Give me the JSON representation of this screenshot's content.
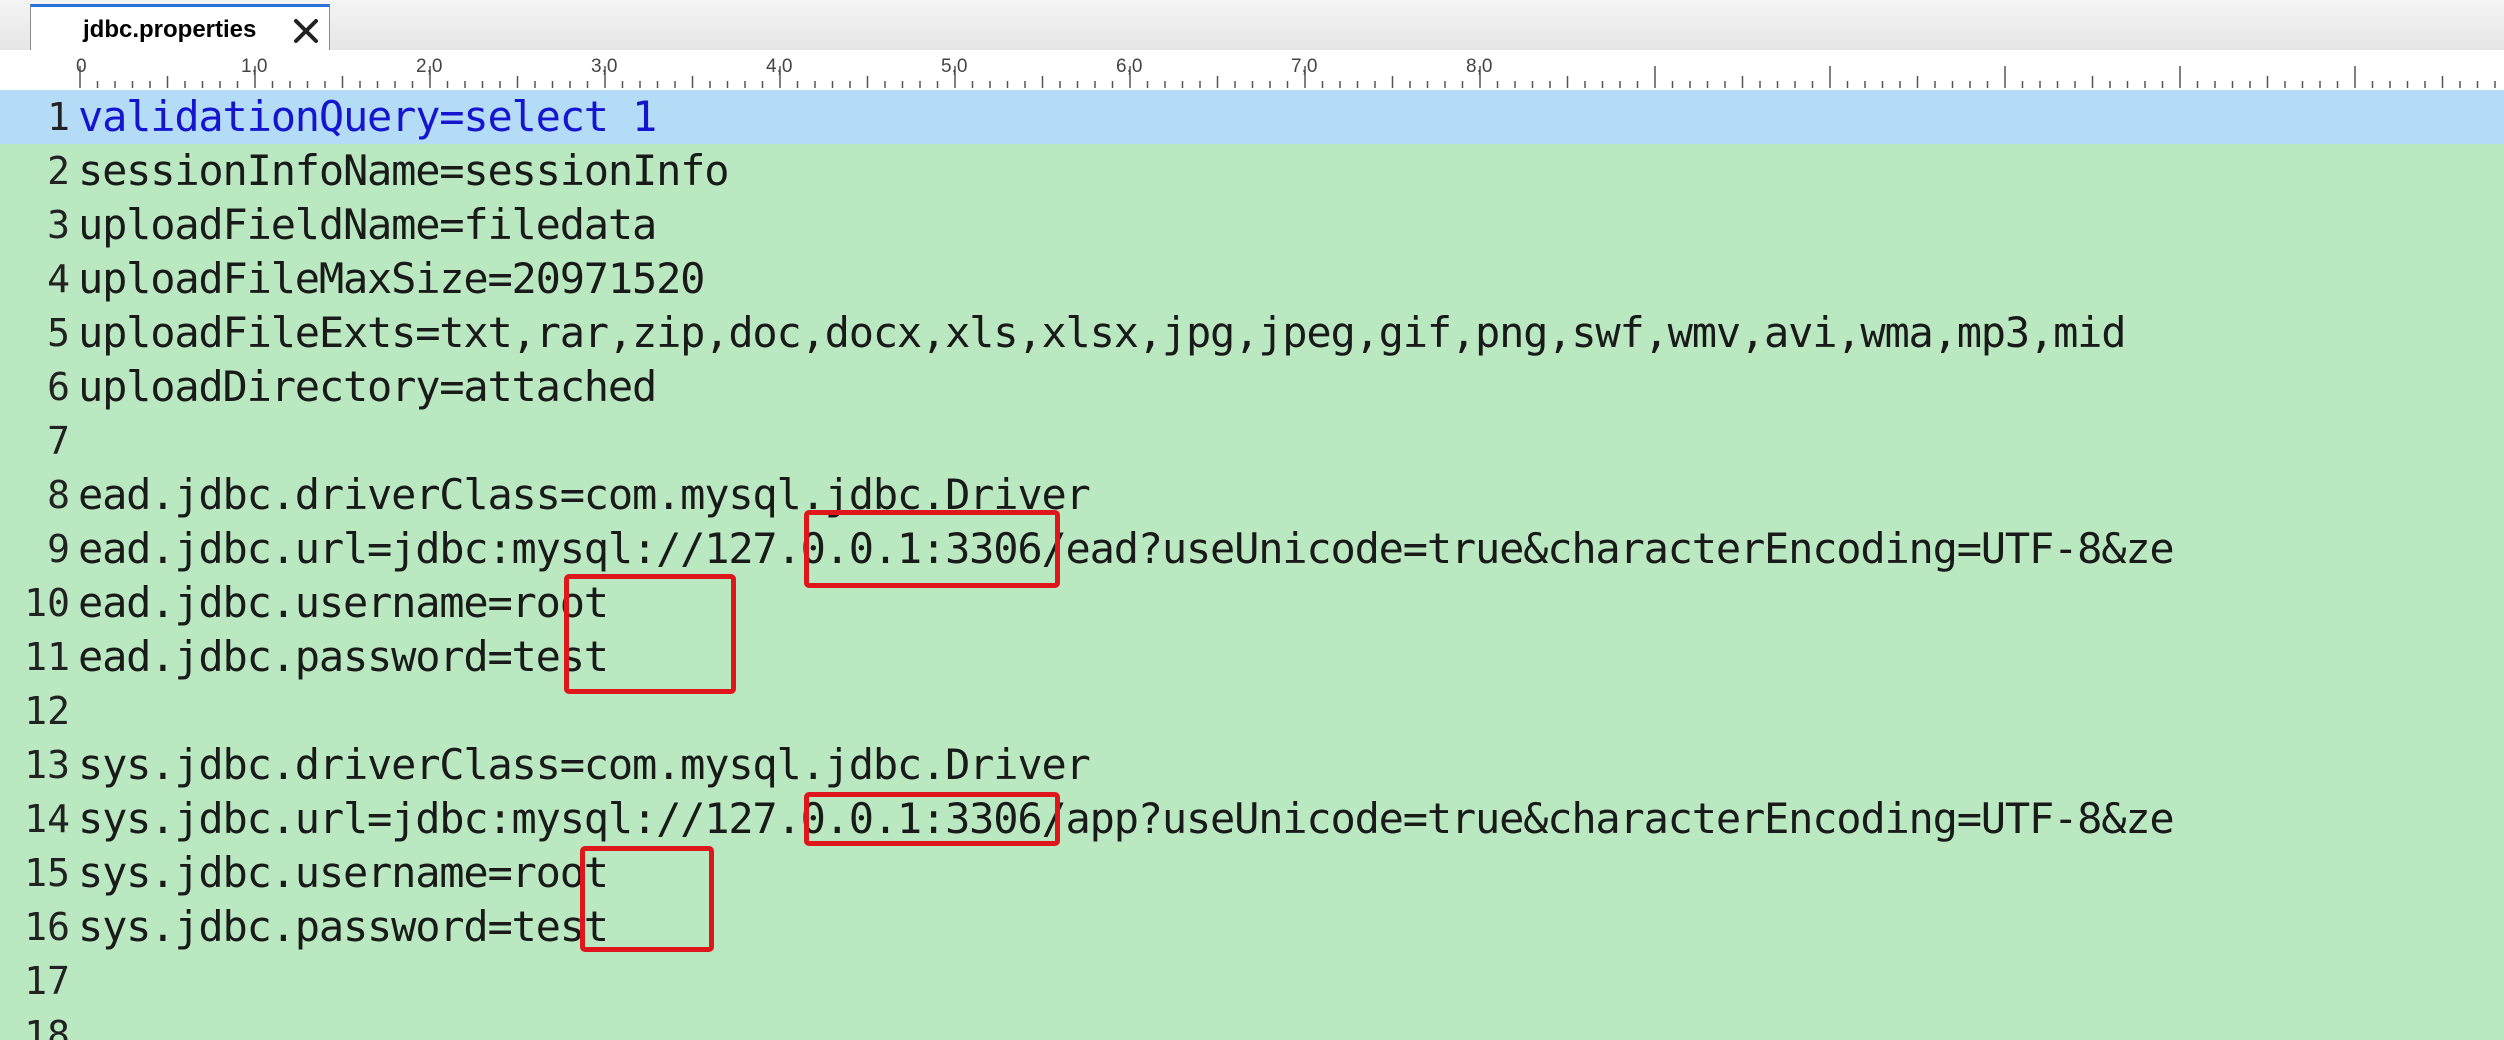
{
  "tab": {
    "title": "jdbc.properties",
    "close_icon": "close-icon"
  },
  "ruler": {
    "labels": [
      "0",
      "1,0",
      "2,0",
      "3,0",
      "4,0",
      "5,0",
      "6,0",
      "7,0",
      "8,0"
    ]
  },
  "editor": {
    "current_line": 1,
    "lines": [
      {
        "num": "1",
        "text": "validationQuery=select 1"
      },
      {
        "num": "2",
        "text": "sessionInfoName=sessionInfo"
      },
      {
        "num": "3",
        "text": "uploadFieldName=filedata"
      },
      {
        "num": "4",
        "text": "uploadFileMaxSize=20971520"
      },
      {
        "num": "5",
        "text": "uploadFileExts=txt,rar,zip,doc,docx,xls,xlsx,jpg,jpeg,gif,png,swf,wmv,avi,wma,mp3,mid"
      },
      {
        "num": "6",
        "text": "uploadDirectory=attached"
      },
      {
        "num": "7",
        "text": ""
      },
      {
        "num": "8",
        "text": "ead.jdbc.driverClass=com.mysql.jdbc.Driver"
      },
      {
        "num": "9",
        "text": "ead.jdbc.url=jdbc:mysql://127.0.0.1:3306/ead?useUnicode=true&characterEncoding=UTF-8&ze"
      },
      {
        "num": "10",
        "text": "ead.jdbc.username=root"
      },
      {
        "num": "11",
        "text": "ead.jdbc.password=test"
      },
      {
        "num": "12",
        "text": ""
      },
      {
        "num": "13",
        "text": "sys.jdbc.driverClass=com.mysql.jdbc.Driver"
      },
      {
        "num": "14",
        "text": "sys.jdbc.url=jdbc:mysql://127.0.0.1:3306/app?useUnicode=true&characterEncoding=UTF-8&ze"
      },
      {
        "num": "15",
        "text": "sys.jdbc.username=root"
      },
      {
        "num": "16",
        "text": "sys.jdbc.password=test"
      },
      {
        "num": "17",
        "text": ""
      },
      {
        "num": "18",
        "text": ""
      }
    ]
  },
  "colors": {
    "editor_background": "#bae9c1",
    "current_line_background": "#b5dcf6",
    "current_line_text": "#1515d0",
    "annotation_box": "#e0161d",
    "tab_accent": "#2b6fd8"
  }
}
